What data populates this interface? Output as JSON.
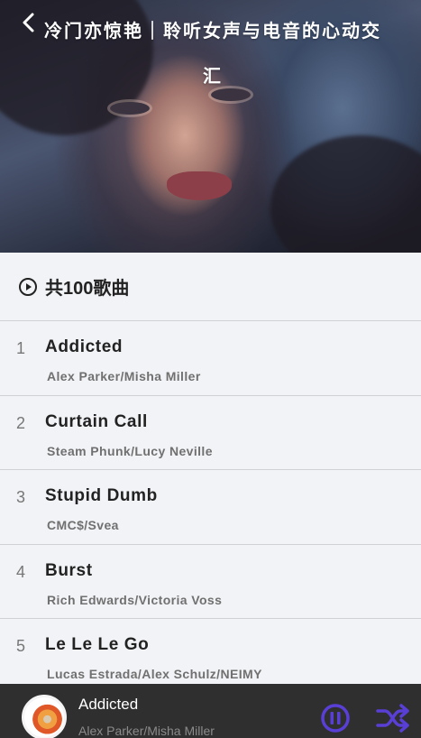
{
  "header": {
    "title": "冷门亦惊艳｜聆听女声与电音的心动交汇",
    "back_icon": "chevron-left-icon"
  },
  "playlist": {
    "count_label": "共100歌曲",
    "count_icon": "play-circle-icon"
  },
  "songs": [
    {
      "index": "1",
      "title": "Addicted",
      "artist": "Alex Parker/Misha Miller"
    },
    {
      "index": "2",
      "title": "Curtain Call",
      "artist": "Steam Phunk/Lucy Neville"
    },
    {
      "index": "3",
      "title": "Stupid Dumb",
      "artist": "CMC$/Svea"
    },
    {
      "index": "4",
      "title": "Burst",
      "artist": "Rich Edwards/Victoria Voss"
    },
    {
      "index": "5",
      "title": "Le Le Le Go",
      "artist": "Lucas Estrada/Alex Schulz/NEIMY"
    }
  ],
  "player": {
    "title": "Addicted",
    "artist": "Alex Parker/Misha Miller",
    "pause_icon": "pause-circle-icon",
    "shuffle_icon": "shuffle-icon"
  },
  "colors": {
    "accent": "#5a3fd6",
    "player_bg": "#2f2f2f",
    "page_bg": "#f2f3f6"
  }
}
